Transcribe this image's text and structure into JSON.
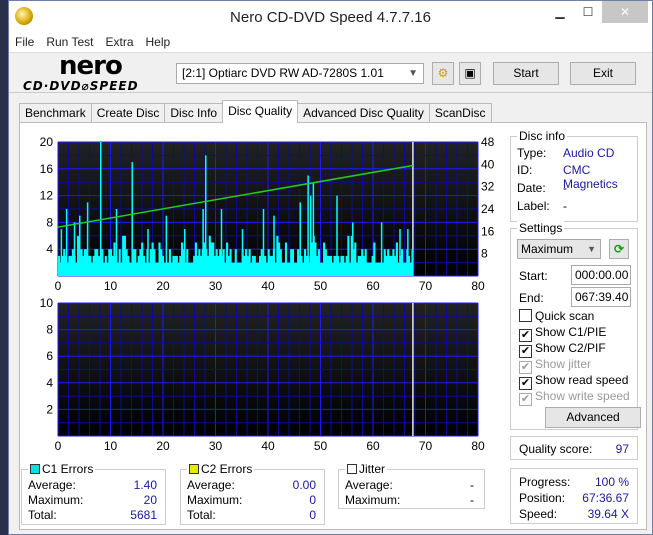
{
  "window": {
    "title": "Nero CD-DVD Speed 4.7.7.16"
  },
  "menu": [
    "File",
    "Run Test",
    "Extra",
    "Help"
  ],
  "toolbar": {
    "logo_top": "nero",
    "logo_bottom": "CD·DVD⌀SPEED",
    "drive": "[2:1]  Optiarc DVD RW AD-7280S 1.01",
    "start_label": "Start",
    "exit_label": "Exit"
  },
  "tabs": [
    {
      "label": "Benchmark",
      "active": false
    },
    {
      "label": "Create Disc",
      "active": false
    },
    {
      "label": "Disc Info",
      "active": false
    },
    {
      "label": "Disc Quality",
      "active": true
    },
    {
      "label": "Advanced Disc Quality",
      "active": false
    },
    {
      "label": "ScanDisc",
      "active": false
    }
  ],
  "disc_info": {
    "title": "Disc info",
    "type_label": "Type:",
    "type": "Audio CD",
    "id_label": "ID:",
    "id": "CMC Magnetics",
    "date_label": "Date:",
    "date": "-",
    "label_label": "Label:",
    "label": "-"
  },
  "settings": {
    "title": "Settings",
    "speed": "Maximum",
    "start_label": "Start:",
    "start": "000:00.00",
    "end_label": "End:",
    "end": "067:39.40",
    "checkboxes": [
      {
        "label": "Quick scan",
        "checked": false,
        "enabled": true
      },
      {
        "label": "Show C1/PIE",
        "checked": true,
        "enabled": true
      },
      {
        "label": "Show C2/PIF",
        "checked": true,
        "enabled": true
      },
      {
        "label": "Show jitter",
        "checked": true,
        "enabled": false
      },
      {
        "label": "Show read speed",
        "checked": true,
        "enabled": true
      },
      {
        "label": "Show write speed",
        "checked": true,
        "enabled": false
      }
    ],
    "advanced_label": "Advanced"
  },
  "quality": {
    "label": "Quality score:",
    "value": "97"
  },
  "status": {
    "progress_label": "Progress:",
    "progress": "100 %",
    "position_label": "Position:",
    "position": "67:36.67",
    "speed_label": "Speed:",
    "speed": "39.64 X"
  },
  "c1": {
    "title": "C1 Errors",
    "color": "#00e0e0",
    "avg_label": "Average:",
    "avg": "1.40",
    "max_label": "Maximum:",
    "max": "20",
    "total_label": "Total:",
    "total": "5681"
  },
  "c2": {
    "title": "C2 Errors",
    "color": "#e8e800",
    "avg_label": "Average:",
    "avg": "0.00",
    "max_label": "Maximum:",
    "max": "0",
    "total_label": "Total:",
    "total": "0"
  },
  "jitter": {
    "title": "Jitter",
    "avg_label": "Average:",
    "avg": "-",
    "max_label": "Maximum:",
    "max": "-"
  },
  "chart_data": [
    {
      "type": "bar",
      "title": "C1 errors and read speed",
      "xlim": [
        0,
        80
      ],
      "x_ticks": [
        "0",
        "10",
        "20",
        "30",
        "40",
        "50",
        "60",
        "70",
        "80"
      ],
      "ylim_left": [
        0,
        20
      ],
      "y_ticks_left": [
        "20",
        "16",
        "12",
        "8",
        "4"
      ],
      "ylim_right": [
        0,
        48
      ],
      "y_ticks_right": [
        "48",
        "40",
        "32",
        "24",
        "16",
        "8"
      ],
      "end_marker_x": 67.6,
      "c1_color": "#00ffff",
      "speed_color": "#22cc22",
      "speed_line": {
        "x": [
          0,
          67.6
        ],
        "y": [
          17.5,
          39.6
        ]
      },
      "c1_spikes": [
        {
          "x": 0.5,
          "y": 7
        },
        {
          "x": 1.5,
          "y": 10
        },
        {
          "x": 3,
          "y": 8
        },
        {
          "x": 4,
          "y": 9
        },
        {
          "x": 5.5,
          "y": 11
        },
        {
          "x": 8,
          "y": 20
        },
        {
          "x": 11,
          "y": 10
        },
        {
          "x": 14,
          "y": 17
        },
        {
          "x": 17,
          "y": 7
        },
        {
          "x": 20.5,
          "y": 9
        },
        {
          "x": 24,
          "y": 7
        },
        {
          "x": 27.5,
          "y": 10
        },
        {
          "x": 28,
          "y": 18
        },
        {
          "x": 31,
          "y": 10
        },
        {
          "x": 35,
          "y": 7
        },
        {
          "x": 39,
          "y": 10
        },
        {
          "x": 41,
          "y": 9
        },
        {
          "x": 46,
          "y": 11
        },
        {
          "x": 47.5,
          "y": 15
        },
        {
          "x": 48,
          "y": 12
        },
        {
          "x": 48.5,
          "y": 14
        },
        {
          "x": 53,
          "y": 12
        },
        {
          "x": 56,
          "y": 8
        },
        {
          "x": 61.5,
          "y": 8
        },
        {
          "x": 65,
          "y": 7
        },
        {
          "x": 66.5,
          "y": 7
        }
      ],
      "c1_baseline_avg": 3
    },
    {
      "type": "bar",
      "title": "C2 errors",
      "xlim": [
        0,
        80
      ],
      "x_ticks": [
        "0",
        "10",
        "20",
        "30",
        "40",
        "50",
        "60",
        "70",
        "80"
      ],
      "ylim": [
        0,
        10
      ],
      "y_ticks": [
        "10",
        "8",
        "6",
        "4",
        "2"
      ],
      "end_marker_x": 67.6,
      "values": []
    }
  ]
}
